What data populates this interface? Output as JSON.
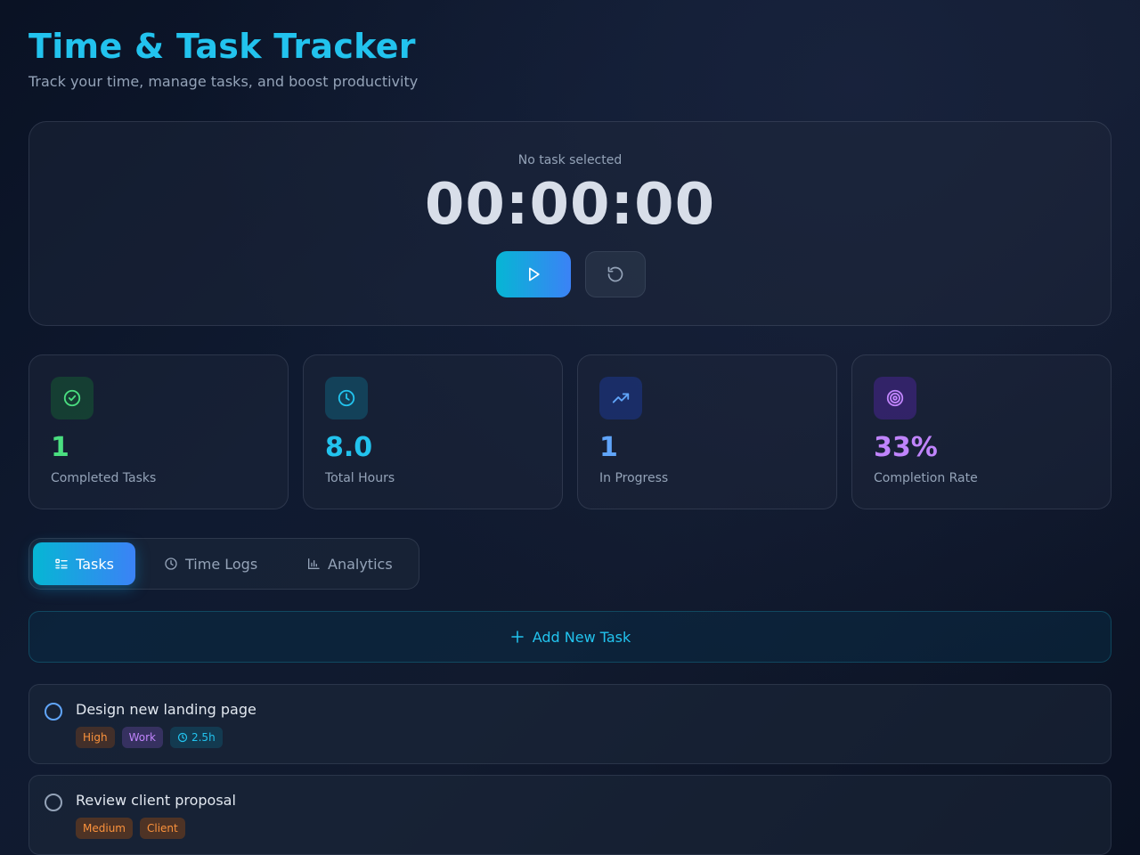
{
  "header": {
    "title": "Time & Task Tracker",
    "subtitle": "Track your time, manage tasks, and boost productivity"
  },
  "timer": {
    "status": "No task selected",
    "display": "00:00:00",
    "play_icon": "play-icon",
    "reset_icon": "reset-icon"
  },
  "stats": [
    {
      "value": "1",
      "label": "Completed Tasks",
      "icon": "check-circle-icon",
      "color": "#4ade80"
    },
    {
      "value": "8.0",
      "label": "Total Hours",
      "icon": "clock-icon",
      "color": "#22c3ee"
    },
    {
      "value": "1",
      "label": "In Progress",
      "icon": "trending-up-icon",
      "color": "#60a5fa"
    },
    {
      "value": "33%",
      "label": "Completion Rate",
      "icon": "target-icon",
      "color": "#c084fc"
    }
  ],
  "tabs": [
    {
      "label": "Tasks",
      "icon": "list-icon",
      "active": true
    },
    {
      "label": "Time Logs",
      "icon": "clock-icon",
      "active": false
    },
    {
      "label": "Analytics",
      "icon": "bar-chart-icon",
      "active": false
    }
  ],
  "add_task": {
    "label": "Add New Task",
    "icon": "plus-icon"
  },
  "tasks": [
    {
      "title": "Design new landing page",
      "tags": [
        "High",
        "Work"
      ],
      "time": "2.5h",
      "status_color": "#60a5fa"
    },
    {
      "title": "Review client proposal",
      "tags": [
        "Medium",
        "Client"
      ],
      "time": "",
      "status_color": "#94a3b8"
    }
  ],
  "colors": {
    "accent": "#22c3ee",
    "accent_gradient_start": "#06b6d4",
    "accent_gradient_end": "#3b82f6"
  }
}
